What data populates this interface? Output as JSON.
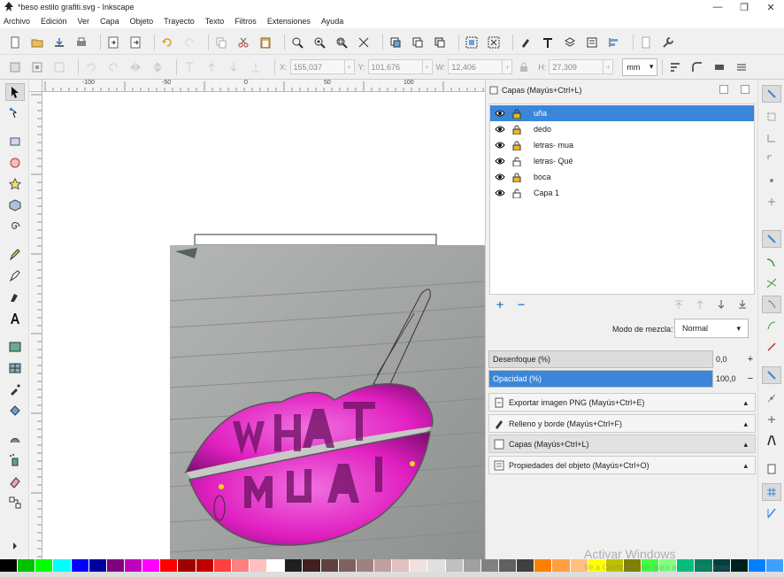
{
  "window": {
    "title": "*beso estilo grafiti.svg - Inkscape",
    "minimize": "—",
    "maximize": "❐",
    "close": "✕"
  },
  "menu": [
    "Archivo",
    "Edición",
    "Ver",
    "Capa",
    "Objeto",
    "Trayecto",
    "Texto",
    "Filtros",
    "Extensiones",
    "Ayuda"
  ],
  "controls": {
    "x_label": "X:",
    "x_value": "155,037",
    "y_label": "Y:",
    "y_value": "101,676",
    "w_label": "W:",
    "w_value": "12,406",
    "h_label": "H:",
    "h_value": "27,309",
    "unit": "mm",
    "spin": "+"
  },
  "ruler": {
    "labels": [
      "-100",
      "-50",
      "0",
      "50",
      "100"
    ]
  },
  "dock": {
    "title": "Capas (Mayús+Ctrl+L)",
    "layers": [
      {
        "name": "uña",
        "locked": true,
        "selected": true
      },
      {
        "name": "dedo",
        "locked": true,
        "selected": false
      },
      {
        "name": "letras- mua",
        "locked": true,
        "selected": false
      },
      {
        "name": "letras- Qué",
        "locked": false,
        "selected": false
      },
      {
        "name": "boca",
        "locked": true,
        "selected": false
      },
      {
        "name": "Capa 1",
        "locked": false,
        "selected": false
      }
    ],
    "add": "+",
    "remove": "−",
    "blend_label": "Modo de mezcla:",
    "blend_value": "Normal",
    "blur_label": "Desenfoque (%)",
    "blur_value": "0,0",
    "blur_btn": "+",
    "opacity_label": "Opacidad (%)",
    "opacity_value": "100,0",
    "opacity_btn": "−",
    "panels": [
      {
        "label": "Exportar imagen PNG (Mayús+Ctrl+E)",
        "active": false
      },
      {
        "label": "Relleno y borde (Mayús+Ctrl+F)",
        "active": false
      },
      {
        "label": "Capas (Mayús+Ctrl+L)",
        "active": true
      },
      {
        "label": "Propiedades del objeto (Mayús+Ctrl+O)",
        "active": false
      }
    ],
    "chevron_down": "▾",
    "chevron_up": "▴"
  },
  "watermark": {
    "line1": "Activar Windows",
    "line2": "Ve a Configuración para activar Windows."
  },
  "palette": [
    "#000000",
    "#00c000",
    "#00ff00",
    "#00ffff",
    "#0000ff",
    "#0000a0",
    "#800080",
    "#c000c0",
    "#ff00ff",
    "#ff0000",
    "#a00000",
    "#c00000",
    "#ff4040",
    "#ff8080",
    "#ffc0c0",
    "#ffffff",
    "#202020",
    "#402020",
    "#604040",
    "#806060",
    "#a08080",
    "#c0a0a0",
    "#e0c0c0",
    "#f0e0e0",
    "#e0e0e0",
    "#c0c0c0",
    "#a0a0a0",
    "#808080",
    "#606060",
    "#404040",
    "#ff8000",
    "#ffa040",
    "#ffc080",
    "#ffff00",
    "#c0c000",
    "#808000",
    "#40ff40",
    "#80ff80",
    "#00c080",
    "#008060",
    "#004040",
    "#002020",
    "#0080ff",
    "#40a0ff"
  ],
  "canvas_colors": {
    "lips": "#e81fc0",
    "selection": "#3a87d9"
  }
}
